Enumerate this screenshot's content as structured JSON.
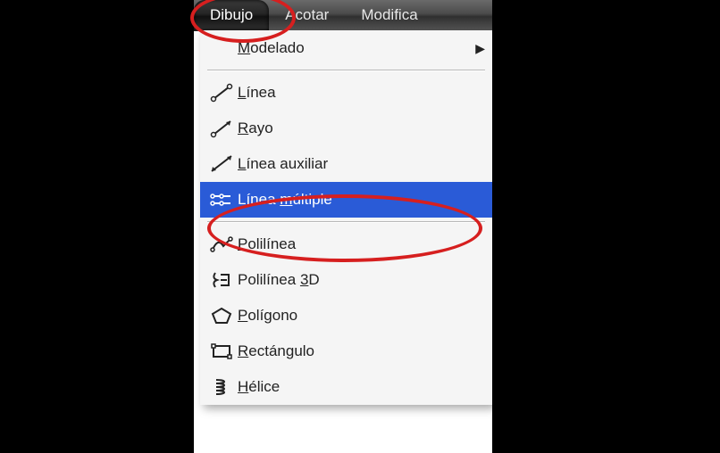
{
  "menubar": {
    "dibujo": "Dibujo",
    "acotar": "Acotar",
    "modificar": "Modifica"
  },
  "dropdown": {
    "modelado": "Modelado",
    "linea": "Línea",
    "rayo": "Rayo",
    "linea_aux": "Línea auxiliar",
    "linea_multiple": "Línea múltiple",
    "polilinea": "Polilínea",
    "polilinea3d": "Polilínea 3D",
    "poligono": "Polígono",
    "rectangulo": "Rectángulo",
    "helice": "Hélice"
  },
  "mnemonic": {
    "linea": "L",
    "rayo": "R",
    "linea_aux": "L",
    "linea_multiple": "m",
    "polilinea": "P",
    "polilinea3d": "3",
    "poligono": "P",
    "rectangulo": "R",
    "helice": "H",
    "modelado": "M"
  }
}
